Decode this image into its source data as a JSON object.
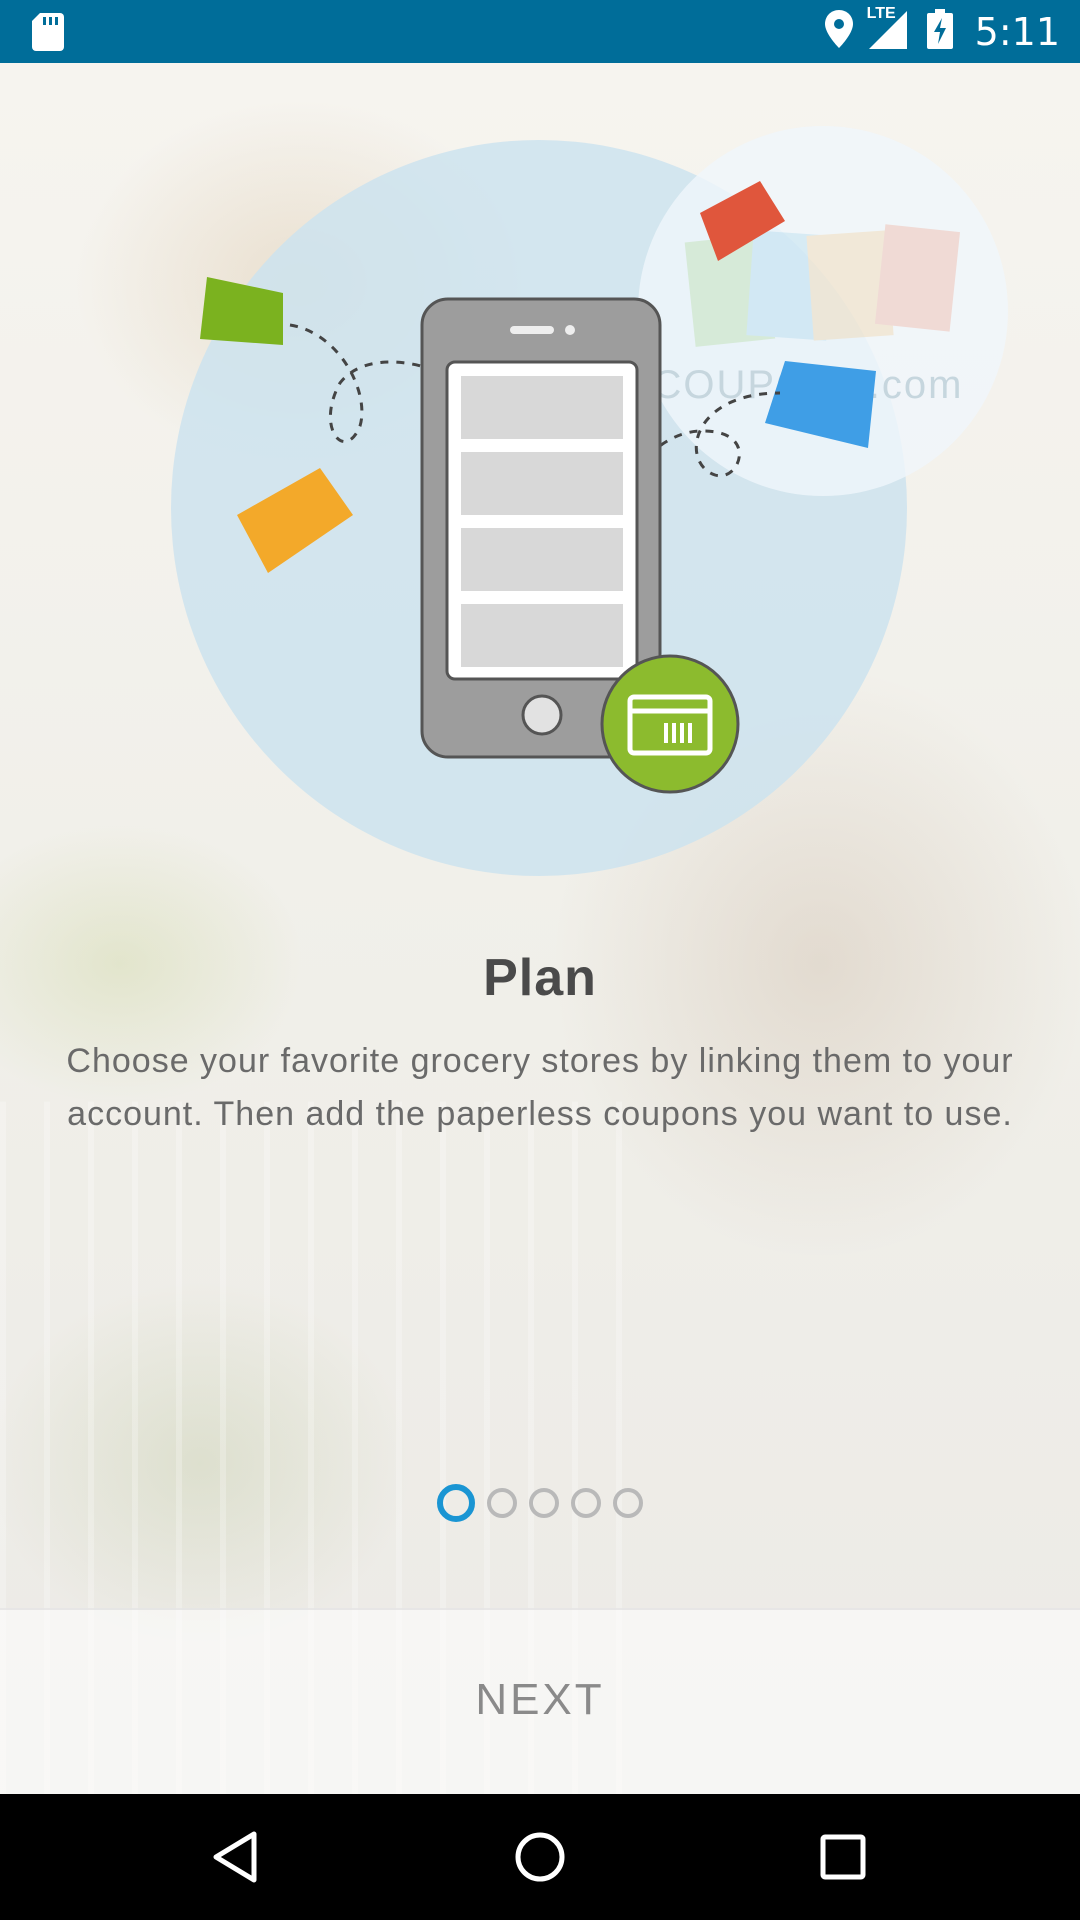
{
  "status_bar": {
    "time": "5:11",
    "network": "LTE",
    "icons": [
      "sd-card-icon",
      "location-icon",
      "lte-signal-icon",
      "battery-charging-icon"
    ]
  },
  "illustration": {
    "watermark": "COUPONS.com"
  },
  "slide": {
    "title": "Plan",
    "body": "Choose your favorite grocery stores by linking them to your account. Then add the paperless coupons you want to use."
  },
  "pager": {
    "total": 5,
    "current": 1
  },
  "footer": {
    "next_label": "NEXT"
  },
  "nav_bar": {
    "icons": [
      "back-icon",
      "home-icon",
      "recents-icon"
    ]
  },
  "colors": {
    "status_bar": "#006d99",
    "accent": "#1a95d3",
    "coupon_green": "#7bb21f",
    "coupon_orange": "#f3a92a",
    "coupon_red": "#e0563c",
    "coupon_blue": "#3f9ee6",
    "badge_green": "#8cbb2e"
  }
}
